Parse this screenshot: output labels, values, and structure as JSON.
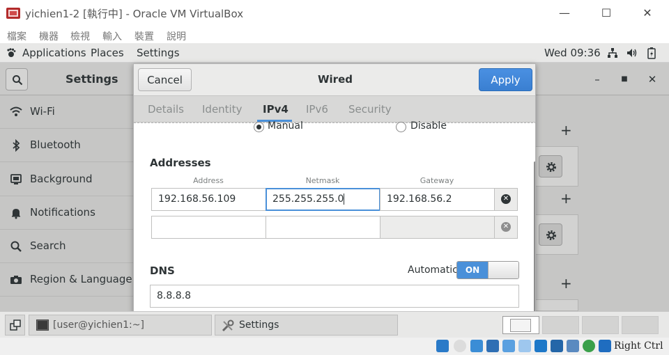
{
  "host": {
    "title": "yichien1-2 [執行中] - Oracle VM VirtualBox",
    "menu": [
      "檔案",
      "機器",
      "檢視",
      "輸入",
      "裝置",
      "說明"
    ],
    "status_right": "Right Ctrl"
  },
  "topbar": {
    "applications": "Applications",
    "places": "Places",
    "settings": "Settings",
    "clock": "Wed 09:36"
  },
  "settings": {
    "title": "Settings",
    "sidebar": [
      {
        "label": "Wi-Fi",
        "icon": "wifi-icon"
      },
      {
        "label": "Bluetooth",
        "icon": "bluetooth-icon"
      },
      {
        "label": "Background",
        "icon": "background-icon"
      },
      {
        "label": "Notifications",
        "icon": "bell-icon"
      },
      {
        "label": "Search",
        "icon": "search-icon"
      },
      {
        "label": "Region & Language",
        "icon": "camera-icon"
      }
    ]
  },
  "dialog": {
    "title": "Wired",
    "cancel": "Cancel",
    "apply": "Apply",
    "tabs": [
      "Details",
      "Identity",
      "IPv4",
      "IPv6",
      "Security"
    ],
    "active_tab": "IPv4",
    "method": {
      "manual": "Manual",
      "disable": "Disable"
    },
    "addresses": {
      "heading": "Addresses",
      "columns": [
        "Address",
        "Netmask",
        "Gateway"
      ],
      "rows": [
        {
          "address": "192.168.56.109",
          "netmask": "255.255.255.0",
          "gateway": "192.168.56.2"
        },
        {
          "address": "",
          "netmask": "",
          "gateway": ""
        }
      ]
    },
    "dns": {
      "heading": "DNS",
      "automatic_label": "Automatic",
      "toggle": "ON",
      "value": "8.8.8.8"
    }
  },
  "taskbar": {
    "terminal": "[user@yichien1:~]",
    "settings": "Settings"
  },
  "colors": {
    "accent": "#4a90d9",
    "apply": "#3a7fd1"
  }
}
